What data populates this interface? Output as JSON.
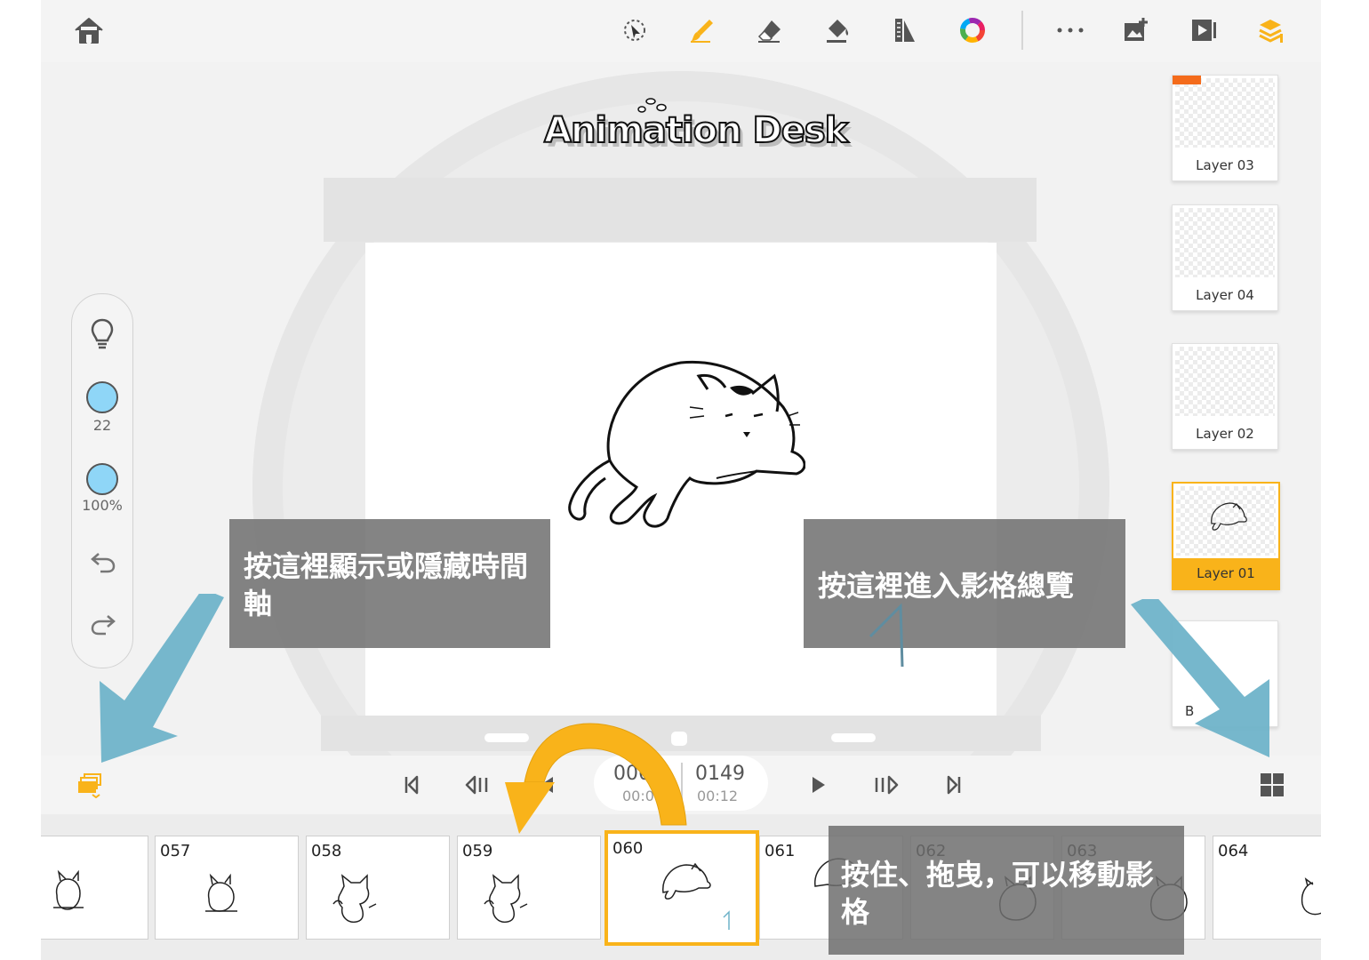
{
  "logo": {
    "text": "Animation Desk"
  },
  "toolbar": {
    "left": [
      {
        "name": "home-icon"
      }
    ],
    "tools": [
      {
        "name": "lasso-select-icon"
      },
      {
        "name": "brush-icon",
        "active": true
      },
      {
        "name": "eraser-icon"
      },
      {
        "name": "paint-bucket-icon"
      },
      {
        "name": "ruler-icon"
      },
      {
        "name": "color-wheel-icon"
      },
      {
        "name": "more-icon"
      },
      {
        "name": "add-image-icon"
      },
      {
        "name": "play-preview-icon"
      },
      {
        "name": "layers-icon",
        "active": true
      }
    ]
  },
  "tool_panel": {
    "brush_size": "22",
    "opacity": "100%",
    "swatch_color": "#8fd6f7"
  },
  "layers": [
    {
      "label": "Layer 03",
      "pro": true
    },
    {
      "label": "Layer 04"
    },
    {
      "label": "Layer 02"
    },
    {
      "label": "Layer 01",
      "active": true
    },
    {
      "label": "B"
    }
  ],
  "playback": {
    "current_frame": "006",
    "current_time": "00:0",
    "total_frames": "0149",
    "total_time": "00:12"
  },
  "timeline": {
    "frames": [
      {
        "number": ""
      },
      {
        "number": "057"
      },
      {
        "number": "058"
      },
      {
        "number": "059"
      },
      {
        "number": "060",
        "current": true
      },
      {
        "number": "061"
      },
      {
        "number": "062"
      },
      {
        "number": "063"
      },
      {
        "number": "064"
      }
    ]
  },
  "annotations": {
    "timeline_toggle": "按這裡顯示或隱藏時間軸",
    "frame_overview": "按這裡進入影格總覽",
    "drag_frames": "按住、拖曳，可以移動影格"
  },
  "colors": {
    "accent": "#f9b31a",
    "arrow": "#6fb3c9",
    "note_bg": "#6e6e6e"
  }
}
